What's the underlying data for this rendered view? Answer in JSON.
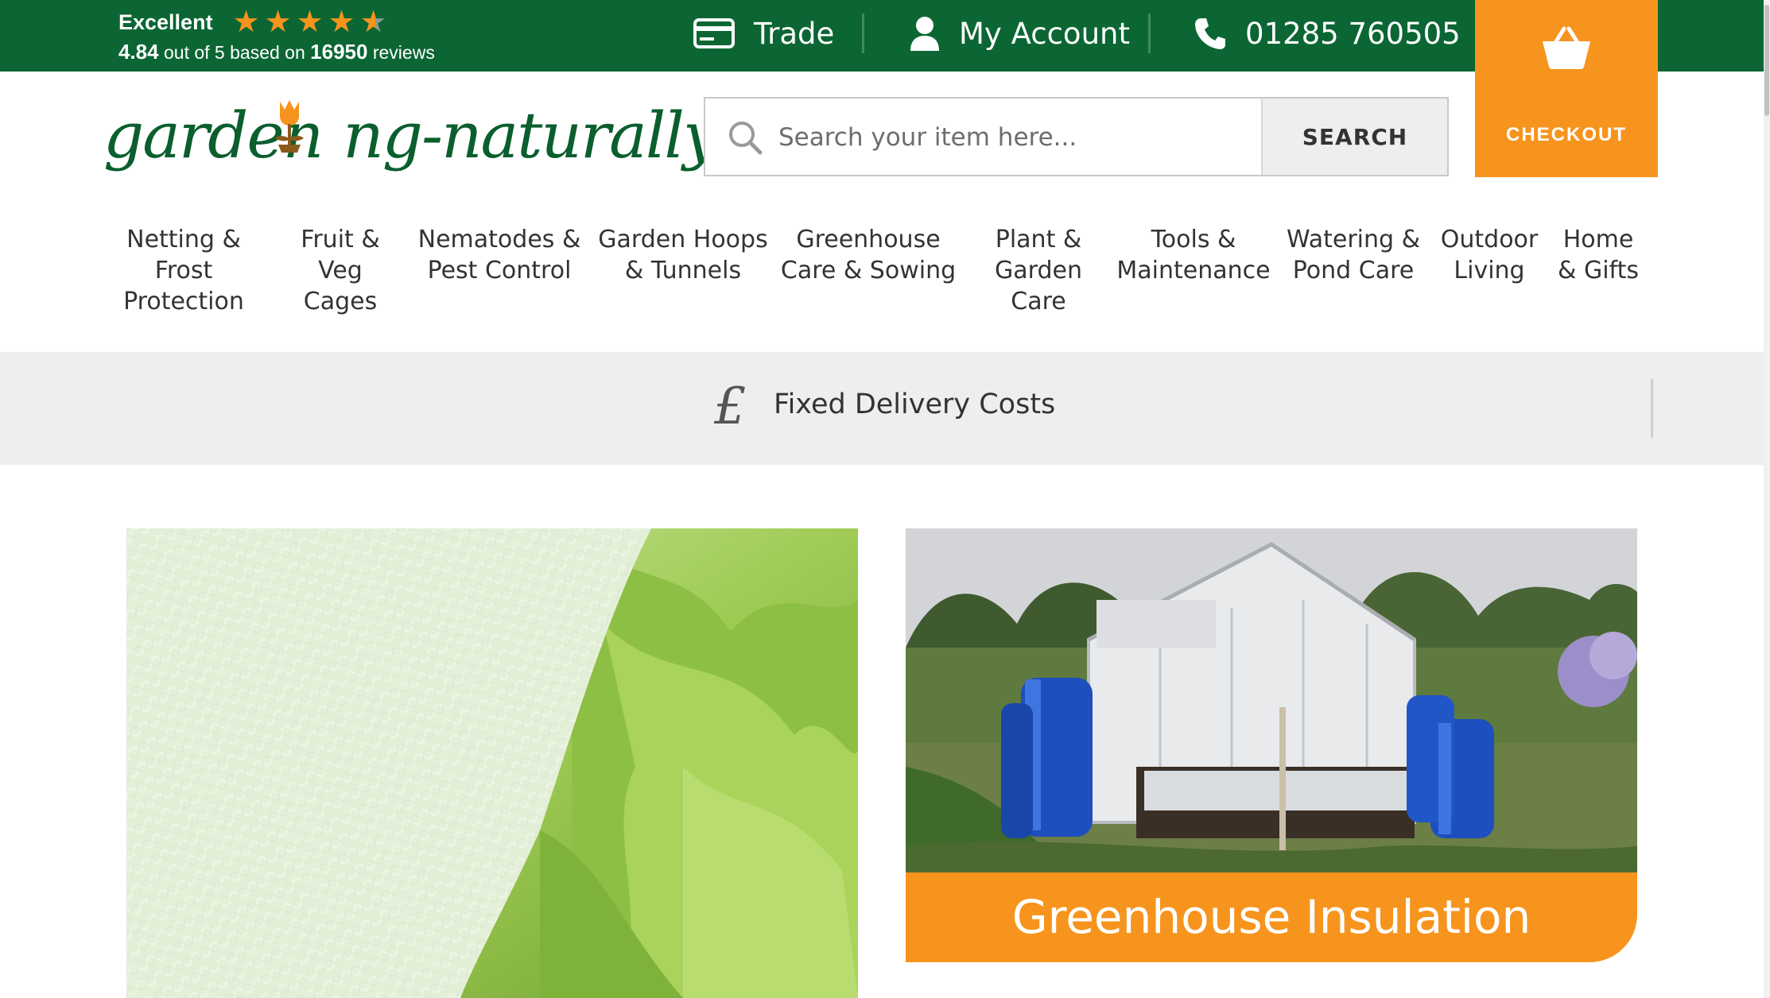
{
  "topbar": {
    "rating": {
      "word": "Excellent",
      "stars": 4.5,
      "score": "4.84",
      "out_of_text": "out of 5 based on",
      "review_count": "16950",
      "reviews_word": "reviews"
    },
    "trade_label": "Trade",
    "account_label": "My Account",
    "phone_label": "01285 760505",
    "checkout_label": "CHECKOUT"
  },
  "logo": {
    "text_before": "garden",
    "text_after": "ng-naturally"
  },
  "search": {
    "placeholder": "Search your item here...",
    "button_label": "SEARCH"
  },
  "nav": {
    "items": [
      {
        "line1": "Netting &",
        "line2": "Frost",
        "line3": "Protection"
      },
      {
        "line1": "Fruit &",
        "line2": "Veg",
        "line3": "Cages"
      },
      {
        "line1": "Nematodes &",
        "line2": "Pest Control",
        "line3": ""
      },
      {
        "line1": "Garden Hoops",
        "line2": "& Tunnels",
        "line3": ""
      },
      {
        "line1": "Greenhouse",
        "line2": "Care & Sowing",
        "line3": ""
      },
      {
        "line1": "Plant &",
        "line2": "Garden",
        "line3": "Care"
      },
      {
        "line1": "Tools &",
        "line2": "Maintenance",
        "line3": ""
      },
      {
        "line1": "Watering &",
        "line2": "Pond Care",
        "line3": ""
      },
      {
        "line1": "Outdoor",
        "line2": "Living",
        "line3": ""
      },
      {
        "line1": "Home",
        "line2": "& Gifts",
        "line3": ""
      }
    ]
  },
  "delivery": {
    "symbol": "£",
    "text": "Fixed Delivery Costs"
  },
  "cards": {
    "right_caption": "Greenhouse Insulation"
  },
  "colors": {
    "brand_green": "#0b6633",
    "accent_orange": "#f7941d",
    "banner_grey": "#eeeeee"
  }
}
